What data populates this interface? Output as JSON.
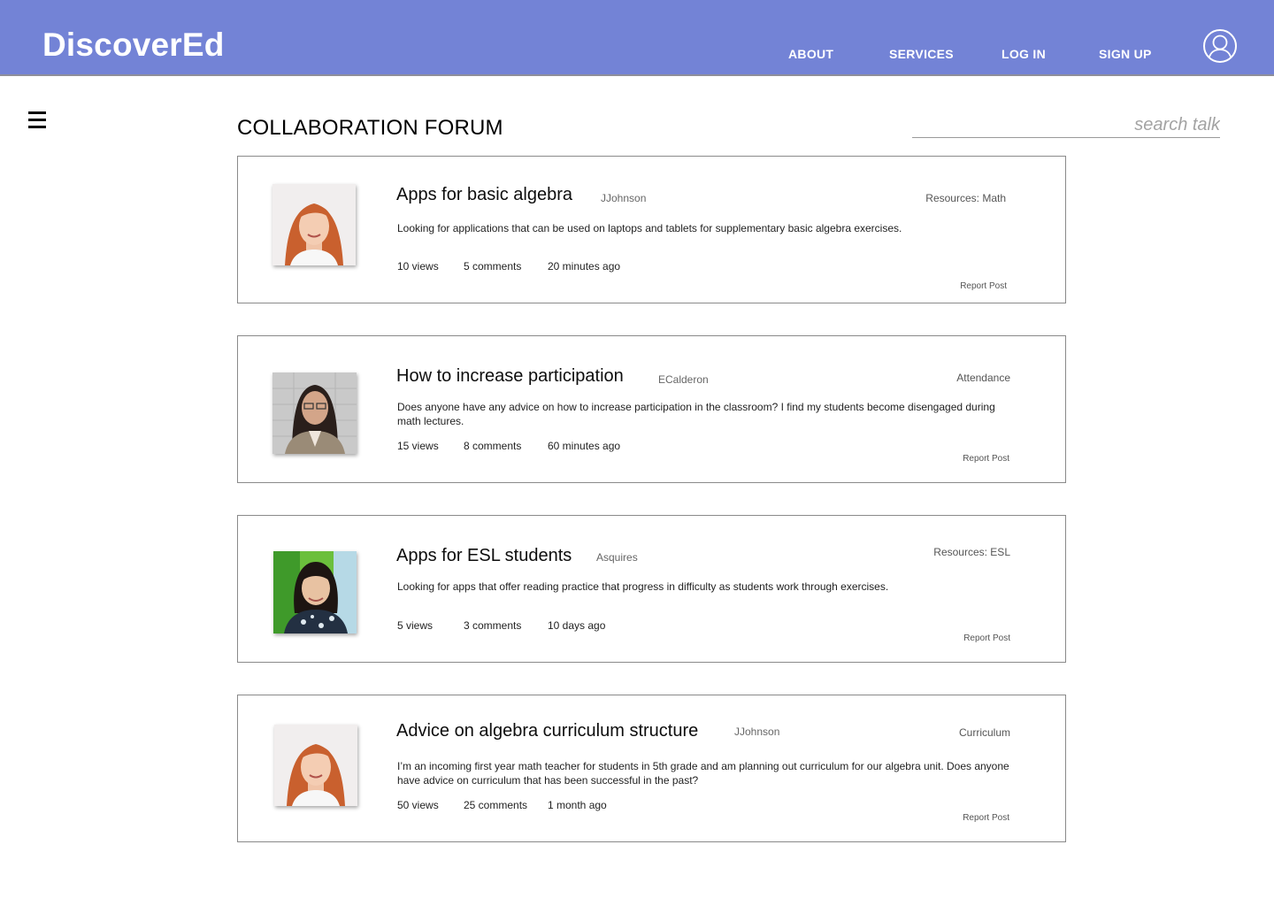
{
  "header": {
    "logo": "DiscoverEd",
    "nav": {
      "about": "ABOUT",
      "services": "SERVICES",
      "login": "LOG IN",
      "signup": "SIGN UP"
    }
  },
  "page": {
    "title": "COLLABORATION FORUM",
    "search_placeholder": "search talk"
  },
  "posts": [
    {
      "title": "Apps for basic algebra",
      "author": "JJohnson",
      "tag": "Resources: Math",
      "body": "Looking for applications that can be used on laptops and tablets for supplementary basic algebra exercises.",
      "views": "10 views",
      "comments": "5 comments",
      "time": "20 minutes ago",
      "report": "Report Post"
    },
    {
      "title": "How to increase participation",
      "author": "ECalderon",
      "tag": "Attendance",
      "body": "Does anyone have any advice on how to increase participation in the classroom? I find my students become disengaged during math lectures.",
      "views": "15 views",
      "comments": "8 comments",
      "time": "60 minutes ago",
      "report": "Report Post"
    },
    {
      "title": "Apps for ESL students",
      "author": "Asquires",
      "tag": "Resources: ESL",
      "body": "Looking for apps that offer reading practice that progress in difficulty as students work through exercises.",
      "views": "5 views",
      "comments": "3 comments",
      "time": "10 days ago",
      "report": "Report Post"
    },
    {
      "title": "Advice on algebra curriculum structure",
      "author": "JJohnson",
      "tag": "Curriculum",
      "body": "I’m an incoming first year math teacher for students in 5th grade and am planning out curriculum for our algebra unit. Does anyone have advice on curriculum that has been successful in the past?",
      "views": "50 views",
      "comments": "25 comments",
      "time": "1 month ago",
      "report": "Report Post"
    }
  ],
  "icons": {
    "menu": "hamburger-menu-icon",
    "profile": "user-profile-icon"
  },
  "colors": {
    "header_bg": "#7383d6",
    "border": "#8a8a8a"
  }
}
